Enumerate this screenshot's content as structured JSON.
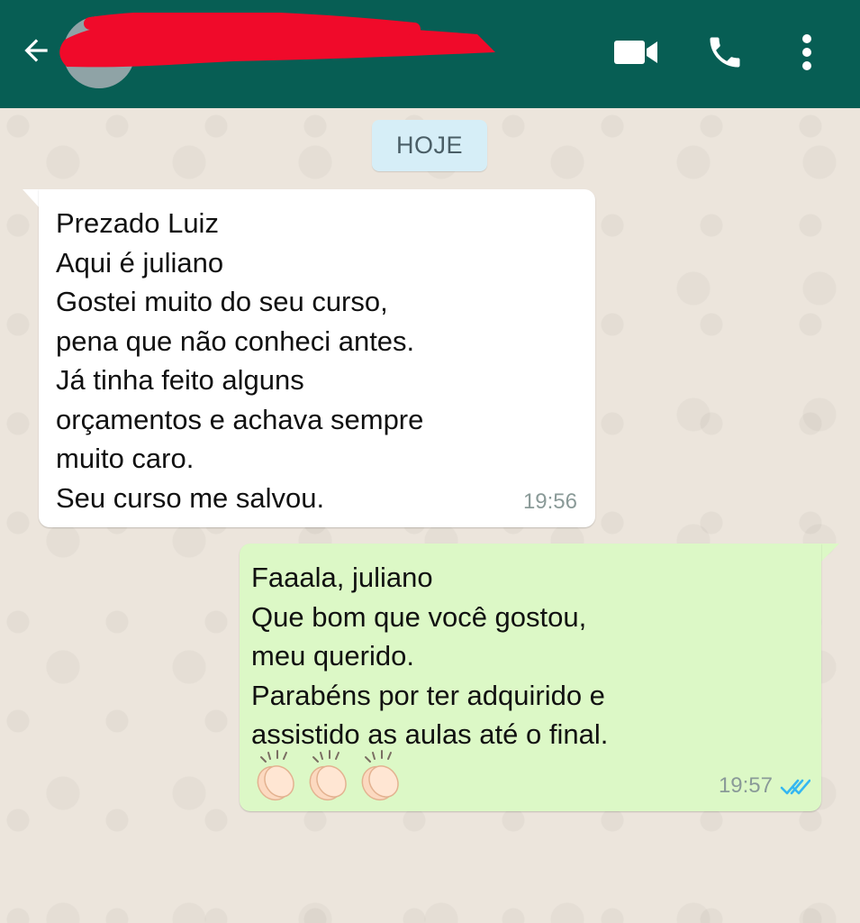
{
  "header": {
    "contact_name_redacted": true
  },
  "icons": {
    "back": "arrow-left-icon",
    "video": "video-call-icon",
    "call": "phone-icon",
    "menu": "more-vert-icon",
    "read": "double-check-icon",
    "clap": "clapping-hands-emoji"
  },
  "colors": {
    "header": "#075e54",
    "incoming_bubble": "#ffffff",
    "outgoing_bubble": "#dcf8c6",
    "date_chip": "#d6eef7",
    "read_ticks": "#34b7f1",
    "redaction": "#f00a2a"
  },
  "date_chip": "HOJE",
  "messages": [
    {
      "direction": "incoming",
      "lines": [
        "Prezado Luiz",
        "Aqui é juliano",
        "Gostei muito do seu curso,",
        "pena que não conheci antes.",
        "Já tinha feito alguns",
        "orçamentos e achava sempre",
        "muito caro.",
        "Seu curso me salvou."
      ],
      "time": "19:56"
    },
    {
      "direction": "outgoing",
      "lines": [
        "Faaala, juliano",
        "Que bom que você gostou,",
        "meu querido.",
        "Parabéns por ter adquirido e",
        "assistido as aulas até o final."
      ],
      "emoji": "👏👏👏",
      "time": "19:57",
      "status": "read"
    }
  ]
}
